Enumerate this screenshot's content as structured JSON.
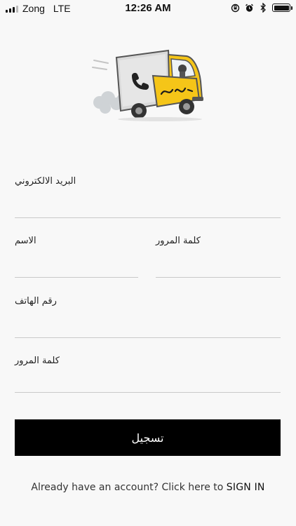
{
  "status_bar": {
    "carrier": "Zong",
    "network": "LTE",
    "time": "12:26 AM",
    "battery_level": 1.0
  },
  "logo": {
    "icon": "delivery-truck-icon",
    "truck_color": "#f5c518",
    "arabic_text": "الونقله"
  },
  "form": {
    "email": {
      "label": "البريد الالكتروني",
      "value": ""
    },
    "name": {
      "label": "الاسم",
      "value": ""
    },
    "password": {
      "label": "كلمة المرور",
      "value": ""
    },
    "phone": {
      "label": "رقم الهاتف",
      "value": ""
    },
    "confirm_password": {
      "label": "كلمة المرور",
      "value": ""
    }
  },
  "register_button": {
    "label": "تسجيل"
  },
  "signin": {
    "prompt": "Already have an account? Click here to",
    "link": "SIGN IN"
  }
}
